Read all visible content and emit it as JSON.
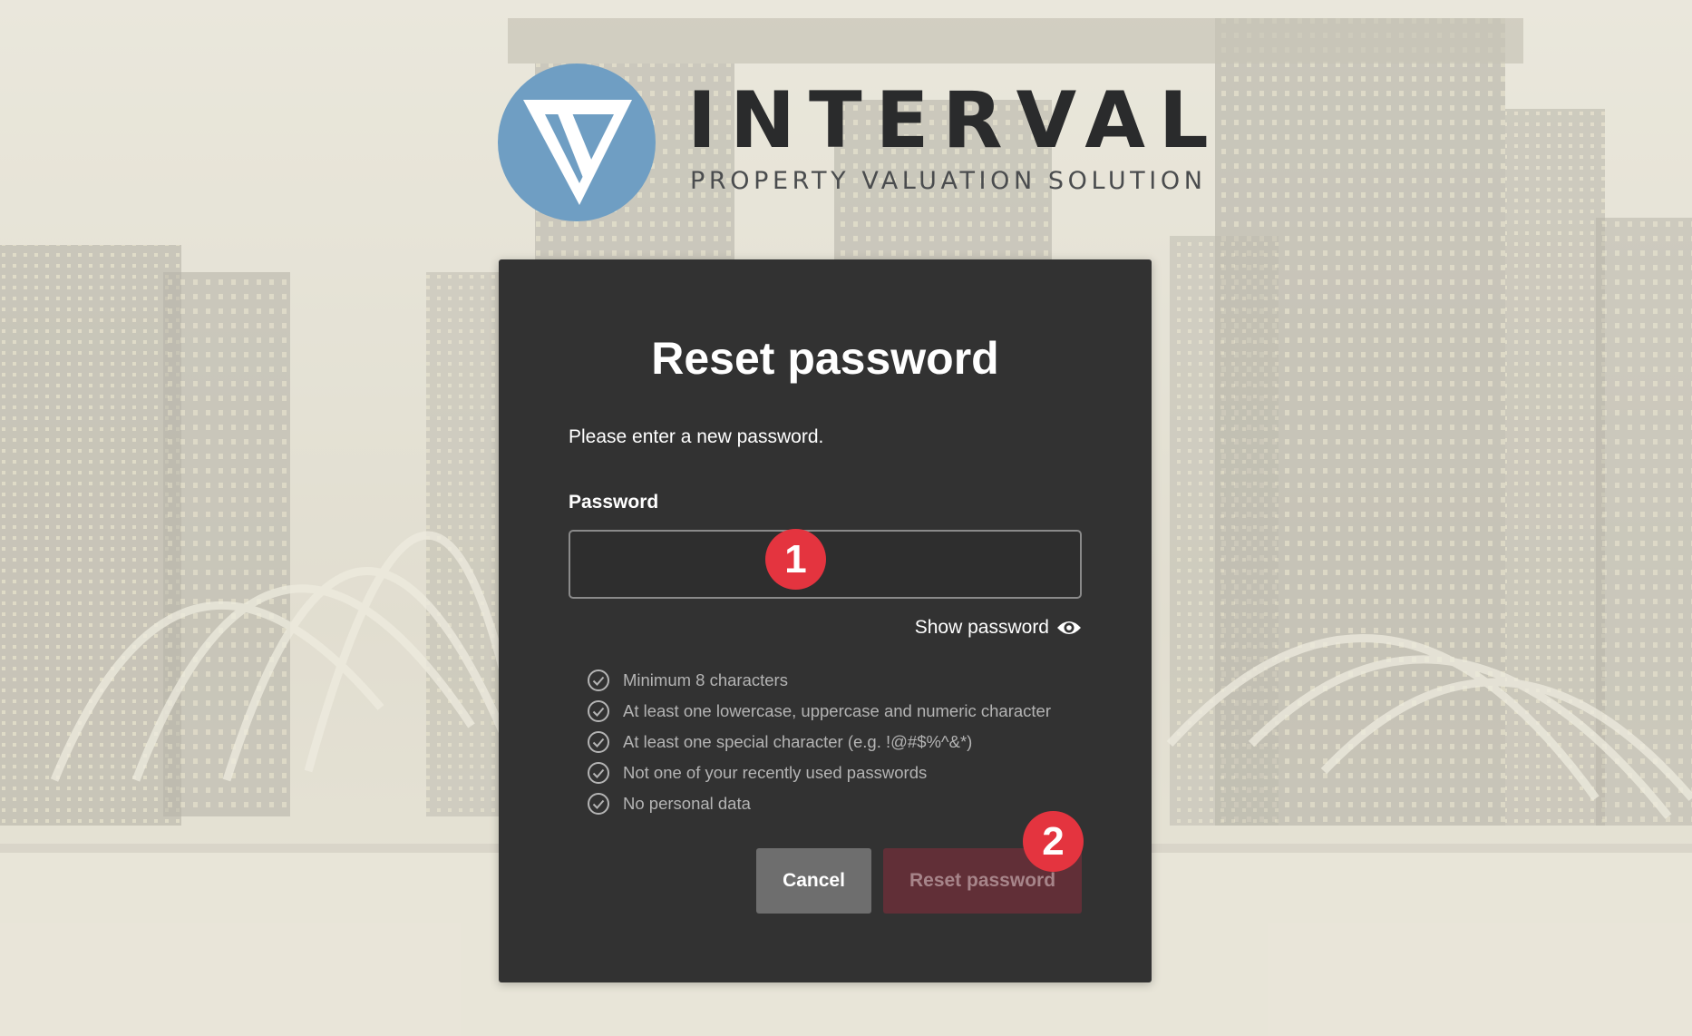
{
  "brand": {
    "name": "INTERVAL",
    "tagline": "PROPERTY VALUATION SOLUTION",
    "logo_color": "#6f9ec3"
  },
  "reset_form": {
    "title": "Reset password",
    "subtitle": "Please enter a new password.",
    "password_label": "Password",
    "password_value": "",
    "show_password_label": "Show password",
    "show_password_icon": "eye-icon",
    "requirements": [
      {
        "text": "Minimum 8 characters",
        "icon": "check-circle-icon"
      },
      {
        "text": "At least one lowercase, uppercase and numeric character",
        "icon": "check-circle-icon"
      },
      {
        "text": "At least one special character (e.g. !@#$%^&*)",
        "icon": "check-circle-icon"
      },
      {
        "text": "Not one of your recently used passwords",
        "icon": "check-circle-icon"
      },
      {
        "text": "No personal data",
        "icon": "check-circle-icon"
      }
    ],
    "cancel_label": "Cancel",
    "submit_label": "Reset password"
  },
  "markers": {
    "one": "1",
    "two": "2"
  },
  "colors": {
    "card_bg": "#323232",
    "cancel_bg": "#6e6e6e",
    "submit_bg_disabled": "#612f37",
    "marker_red": "#e4343f"
  }
}
